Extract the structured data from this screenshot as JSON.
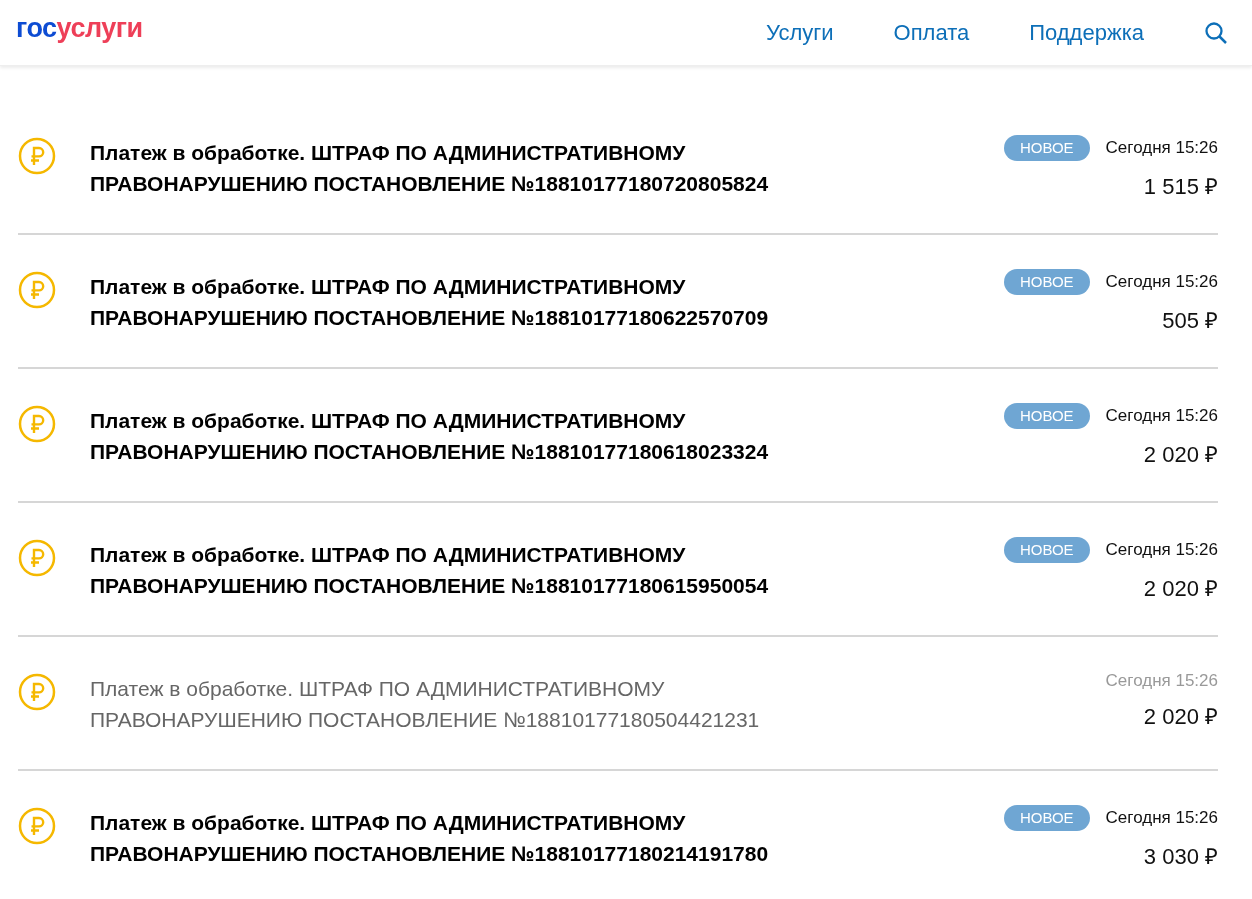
{
  "header": {
    "logo": [
      {
        "text": "гос",
        "color": "#0d4cd3"
      },
      {
        "text": "услуги",
        "color": "#ee3f58"
      }
    ],
    "nav": [
      {
        "label": "Услуги"
      },
      {
        "label": "Оплата"
      },
      {
        "label": "Поддержка"
      }
    ]
  },
  "payments": [
    {
      "title": "Платеж в обработке. ШТРАФ ПО АДМИНИСТРАТИВНОМУ ПРАВОНАРУШЕНИЮ ПОСТАНОВЛЕНИЕ №18810177180720805824",
      "unread": true,
      "badge": "НОВОЕ",
      "date": "Сегодня 15:26",
      "amount": "1 515 ₽"
    },
    {
      "title": "Платеж в обработке. ШТРАФ ПО АДМИНИСТРАТИВНОМУ ПРАВОНАРУШЕНИЮ ПОСТАНОВЛЕНИЕ №18810177180622570709",
      "unread": true,
      "badge": "НОВОЕ",
      "date": "Сегодня 15:26",
      "amount": "505 ₽"
    },
    {
      "title": "Платеж в обработке. ШТРАФ ПО АДМИНИСТРАТИВНОМУ ПРАВОНАРУШЕНИЮ ПОСТАНОВЛЕНИЕ №18810177180618023324",
      "unread": true,
      "badge": "НОВОЕ",
      "date": "Сегодня 15:26",
      "amount": "2 020 ₽"
    },
    {
      "title": "Платеж в обработке. ШТРАФ ПО АДМИНИСТРАТИВНОМУ ПРАВОНАРУШЕНИЮ ПОСТАНОВЛЕНИЕ №18810177180615950054",
      "unread": true,
      "badge": "НОВОЕ",
      "date": "Сегодня 15:26",
      "amount": "2 020 ₽"
    },
    {
      "title": "Платеж в обработке. ШТРАФ ПО АДМИНИСТРАТИВНОМУ ПРАВОНАРУШЕНИЮ ПОСТАНОВЛЕНИЕ №18810177180504421231",
      "unread": false,
      "date": "Сегодня 15:26",
      "amount": "2 020 ₽"
    },
    {
      "title": "Платеж в обработке. ШТРАФ ПО АДМИНИСТРАТИВНОМУ ПРАВОНАРУШЕНИЮ ПОСТАНОВЛЕНИЕ №18810177180214191780",
      "unread": true,
      "badge": "НОВОЕ",
      "date": "Сегодня 15:26",
      "amount": "3 030 ₽"
    }
  ]
}
